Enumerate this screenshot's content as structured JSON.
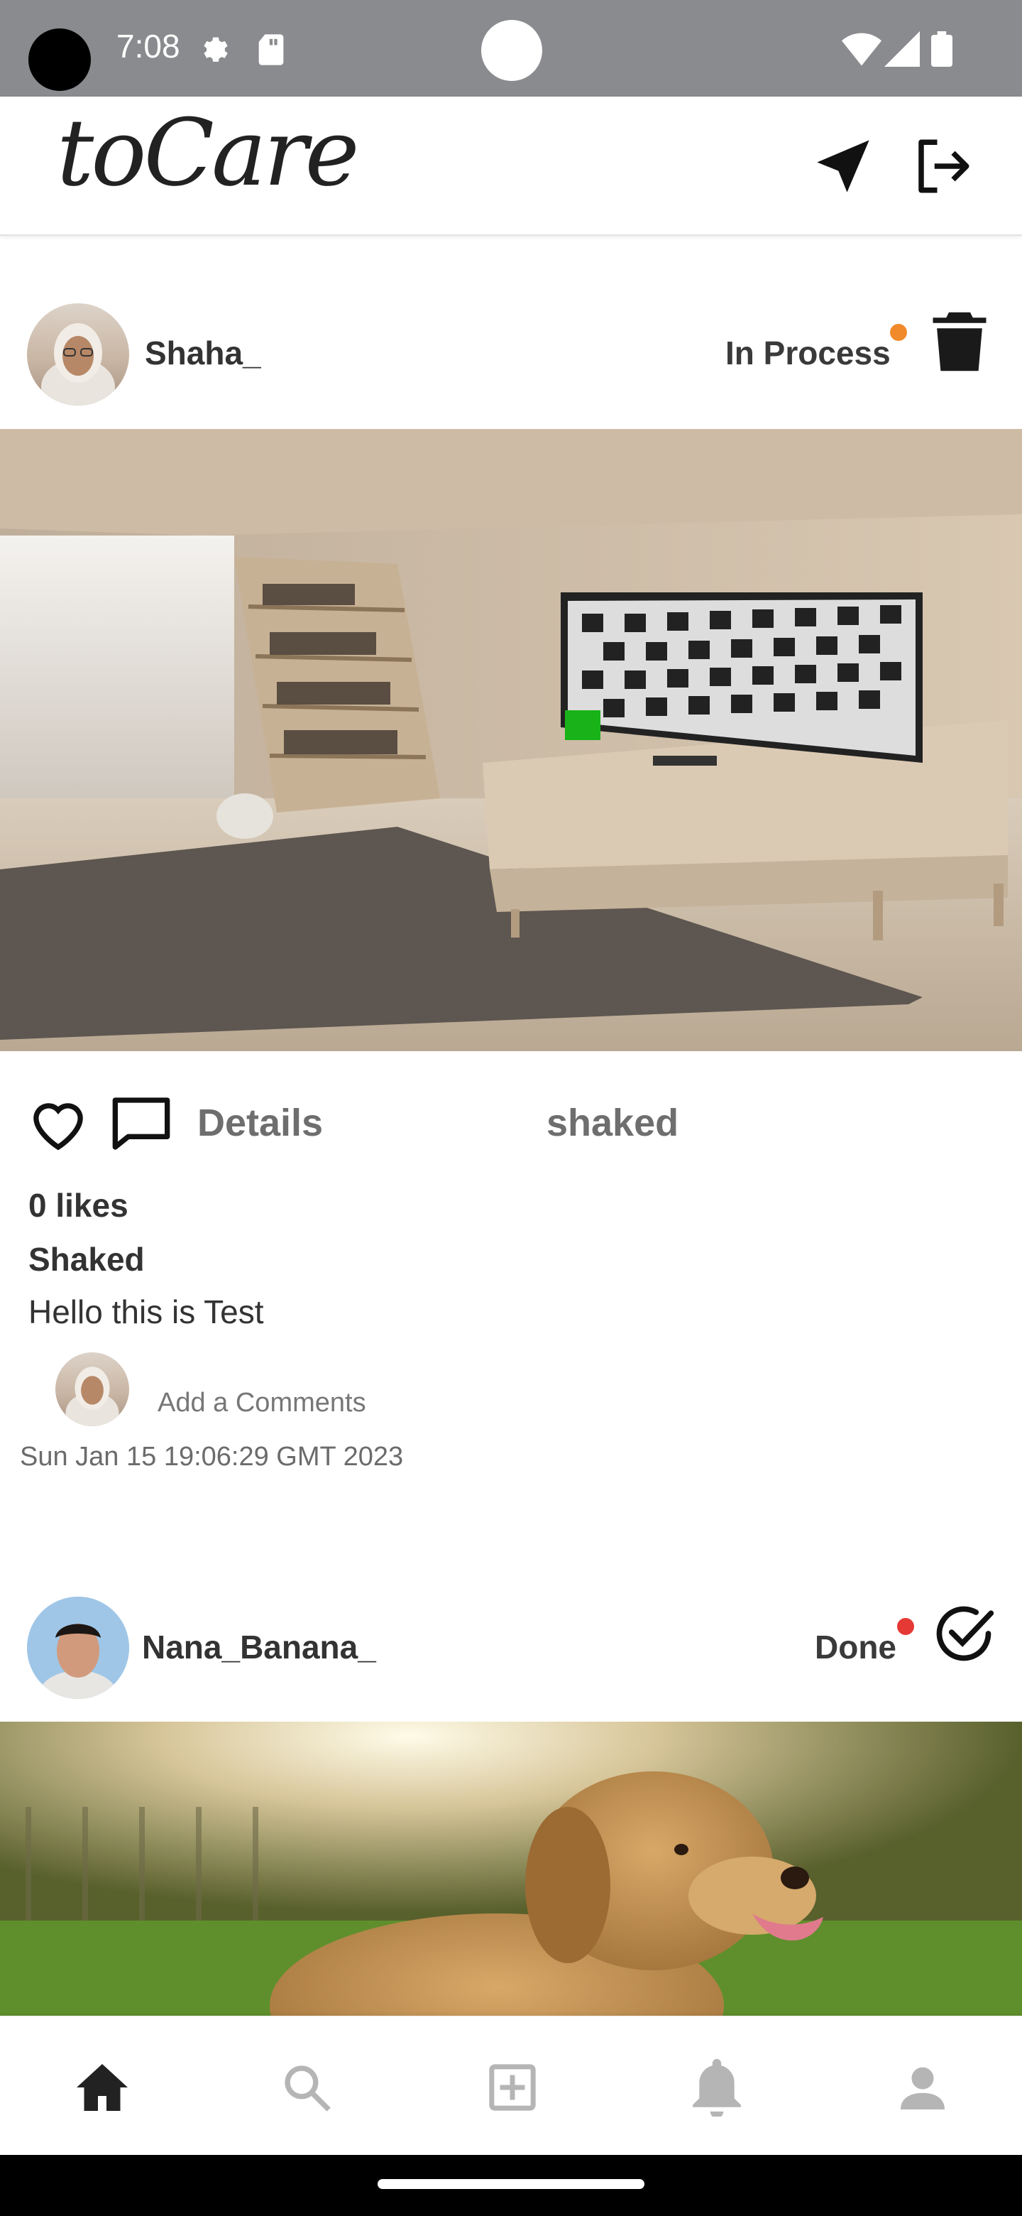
{
  "status_bar": {
    "time": "7:08",
    "icons": [
      "settings-gear-icon",
      "sd-card-icon",
      "wifi-icon",
      "signal-icon",
      "battery-icon"
    ]
  },
  "app_bar": {
    "logo_text": "toCare",
    "actions": [
      "send-icon",
      "logout-icon"
    ]
  },
  "posts": [
    {
      "username": "Shaha_",
      "status": "In Process",
      "status_color": "#f08a2b",
      "status_action_icon": "trash-icon",
      "image_desc": "room-interior-photo",
      "details_label": "Details",
      "tag": "shaked",
      "likes": "0 likes",
      "author": "Shaked",
      "caption": "Hello this is Test",
      "comment_placeholder": "Add a Comments",
      "timestamp": "Sun Jan 15 19:06:29 GMT 2023"
    },
    {
      "username": "Nana_Banana_",
      "status": "Done",
      "status_color": "#e53935",
      "status_action_icon": "check-circle-icon",
      "image_desc": "golden-retriever-photo"
    }
  ],
  "bottom_nav": {
    "items": [
      "home-icon",
      "search-icon",
      "add-post-icon",
      "notifications-icon",
      "profile-icon"
    ],
    "active": "home-icon"
  },
  "colors": {
    "status_bar_bg": "#8a8b8e",
    "icon_dark": "#222222",
    "icon_inactive": "#b5b5b5"
  }
}
